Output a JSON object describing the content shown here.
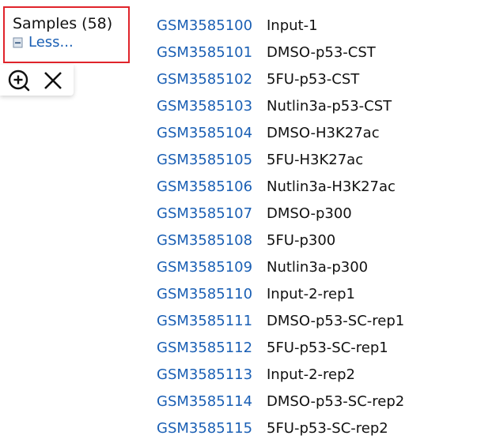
{
  "samples_header": {
    "title": "Samples (58)",
    "less_label": "Less..."
  },
  "toolbar": {
    "zoom_icon": "zoom-in-icon",
    "close_icon": "close-icon"
  },
  "samples": [
    {
      "id": "GSM3585100",
      "name": "Input-1"
    },
    {
      "id": "GSM3585101",
      "name": "DMSO-p53-CST"
    },
    {
      "id": "GSM3585102",
      "name": "5FU-p53-CST"
    },
    {
      "id": "GSM3585103",
      "name": "Nutlin3a-p53-CST"
    },
    {
      "id": "GSM3585104",
      "name": "DMSO-H3K27ac"
    },
    {
      "id": "GSM3585105",
      "name": "5FU-H3K27ac"
    },
    {
      "id": "GSM3585106",
      "name": "Nutlin3a-H3K27ac"
    },
    {
      "id": "GSM3585107",
      "name": "DMSO-p300"
    },
    {
      "id": "GSM3585108",
      "name": "5FU-p300"
    },
    {
      "id": "GSM3585109",
      "name": "Nutlin3a-p300"
    },
    {
      "id": "GSM3585110",
      "name": "Input-2-rep1"
    },
    {
      "id": "GSM3585111",
      "name": "DMSO-p53-SC-rep1"
    },
    {
      "id": "GSM3585112",
      "name": "5FU-p53-SC-rep1"
    },
    {
      "id": "GSM3585113",
      "name": "Input-2-rep2"
    },
    {
      "id": "GSM3585114",
      "name": "DMSO-p53-SC-rep2"
    },
    {
      "id": "GSM3585115",
      "name": "5FU-p53-SC-rep2"
    }
  ],
  "colors": {
    "link": "#1a5fb4",
    "highlight_border": "#e0242b",
    "text": "#111111"
  }
}
